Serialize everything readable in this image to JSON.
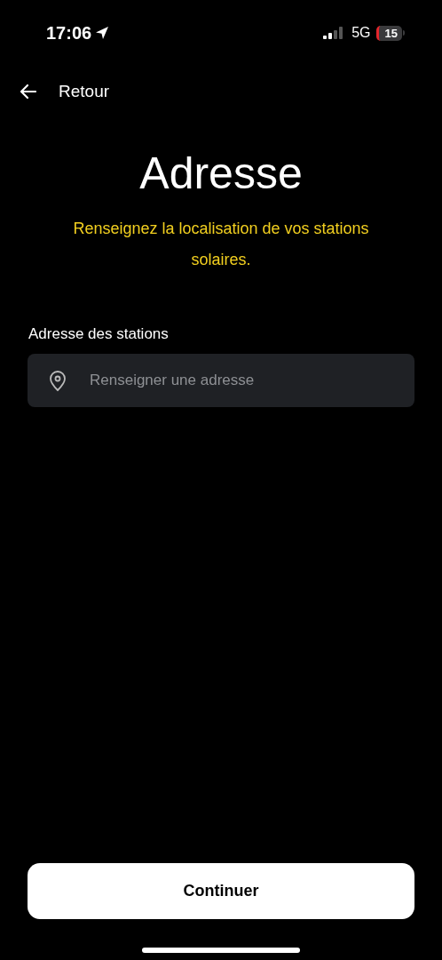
{
  "status_bar": {
    "time": "17:06",
    "network": "5G",
    "battery": "15"
  },
  "nav": {
    "back_label": "Retour"
  },
  "title": "Adresse",
  "subtitle": "Renseignez la localisation de vos stations solaires.",
  "field": {
    "label": "Adresse des stations",
    "placeholder": "Renseigner une adresse"
  },
  "buttons": [
    "Continuer"
  ]
}
